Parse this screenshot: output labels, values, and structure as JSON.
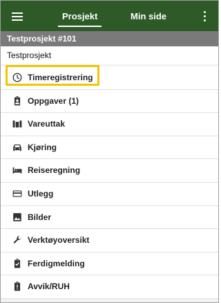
{
  "header": {
    "tabs": [
      {
        "label": "Prosjekt",
        "active": true
      },
      {
        "label": "Min side",
        "active": false
      }
    ],
    "color": "#2d5a27"
  },
  "project_bar": {
    "title": "Testprosjekt #101"
  },
  "subheader": {
    "title": "Testprosjekt"
  },
  "menu": {
    "items": [
      {
        "label": "Timeregistrering",
        "icon": "clock-icon",
        "highlighted": true
      },
      {
        "label": "Oppgaver (1)",
        "icon": "clipboard-account-icon"
      },
      {
        "label": "Vareuttak",
        "icon": "warehouse-shelf-icon"
      },
      {
        "label": "Kjøring",
        "icon": "car-icon"
      },
      {
        "label": "Reiseregning",
        "icon": "bed-icon"
      },
      {
        "label": "Utlegg",
        "icon": "credit-card-icon"
      },
      {
        "label": "Bilder",
        "icon": "image-icon"
      },
      {
        "label": "Verktøyoversikt",
        "icon": "wrench-icon"
      },
      {
        "label": "Ferdigmelding",
        "icon": "clipboard-check-icon"
      },
      {
        "label": "Avvik/RUH",
        "icon": "clipboard-alert-icon"
      }
    ],
    "highlight_color": "#f2c500"
  }
}
